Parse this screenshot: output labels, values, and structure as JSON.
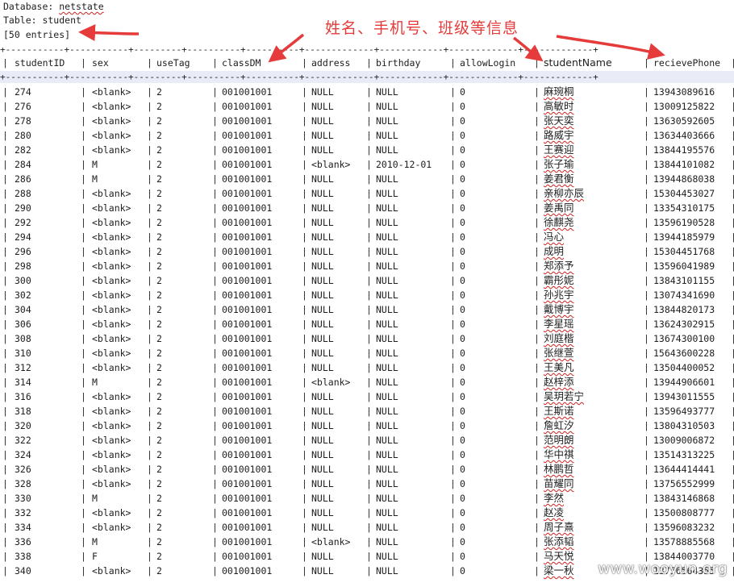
{
  "meta": {
    "db_label": "Database: ",
    "db_name": "netstate",
    "table_label": "Table: student",
    "entries": "[50 entries]"
  },
  "annotation": {
    "text": "姓名、手机号、班级等信息",
    "color": "#e53b3b"
  },
  "table": {
    "separator": "+-----------+-----------+---------+----------+----------+-------------+------------+-------------+-------------+",
    "columns": [
      "studentID",
      "sex",
      "useTag",
      "classDM",
      "address",
      "birthday",
      "allowLogin",
      "studentName",
      "recievePhone"
    ],
    "rows": [
      [
        "274",
        "<blank>",
        "2",
        "001001001",
        "NULL",
        "NULL",
        "0",
        "麻琬桐",
        "13943089616"
      ],
      [
        "276",
        "<blank>",
        "2",
        "001001001",
        "NULL",
        "NULL",
        "0",
        "高敏时",
        "13009125822"
      ],
      [
        "278",
        "<blank>",
        "2",
        "001001001",
        "NULL",
        "NULL",
        "0",
        "张天奕",
        "13630592605"
      ],
      [
        "280",
        "<blank>",
        "2",
        "001001001",
        "NULL",
        "NULL",
        "0",
        "路威宇",
        "13634403666"
      ],
      [
        "282",
        "<blank>",
        "2",
        "001001001",
        "NULL",
        "NULL",
        "0",
        "王赛迎",
        "13844195576"
      ],
      [
        "284",
        "M",
        "2",
        "001001001",
        "<blank>",
        "2010-12-01",
        "0",
        "张子瑜",
        "13844101082"
      ],
      [
        "286",
        "M",
        "2",
        "001001001",
        "NULL",
        "NULL",
        "0",
        "姜君衡",
        "13944868038"
      ],
      [
        "288",
        "<blank>",
        "2",
        "001001001",
        "NULL",
        "NULL",
        "0",
        "亲柳亦辰",
        "15304453027"
      ],
      [
        "290",
        "<blank>",
        "2",
        "001001001",
        "NULL",
        "NULL",
        "0",
        "姜禹同",
        "13354310175"
      ],
      [
        "292",
        "<blank>",
        "2",
        "001001001",
        "NULL",
        "NULL",
        "0",
        "徐麒尧",
        "13596190528"
      ],
      [
        "294",
        "<blank>",
        "2",
        "001001001",
        "NULL",
        "NULL",
        "0",
        "冯心",
        "13944185979"
      ],
      [
        "296",
        "<blank>",
        "2",
        "001001001",
        "NULL",
        "NULL",
        "0",
        "成明",
        "15304451768"
      ],
      [
        "298",
        "<blank>",
        "2",
        "001001001",
        "NULL",
        "NULL",
        "0",
        "郑添予",
        "13596041989"
      ],
      [
        "300",
        "<blank>",
        "2",
        "001001001",
        "NULL",
        "NULL",
        "0",
        "霸彤妮",
        "13843101155"
      ],
      [
        "302",
        "<blank>",
        "2",
        "001001001",
        "NULL",
        "NULL",
        "0",
        "孙兆宇",
        "13074341690"
      ],
      [
        "304",
        "<blank>",
        "2",
        "001001001",
        "NULL",
        "NULL",
        "0",
        "戴博宇",
        "13844820173"
      ],
      [
        "306",
        "<blank>",
        "2",
        "001001001",
        "NULL",
        "NULL",
        "0",
        "李星瑶",
        "13624302915"
      ],
      [
        "308",
        "<blank>",
        "2",
        "001001001",
        "NULL",
        "NULL",
        "0",
        "刘庭楷",
        "13674300100"
      ],
      [
        "310",
        "<blank>",
        "2",
        "001001001",
        "NULL",
        "NULL",
        "0",
        "张继萱",
        "15643600228"
      ],
      [
        "312",
        "<blank>",
        "2",
        "001001001",
        "NULL",
        "NULL",
        "0",
        "王美凡",
        "13504400052"
      ],
      [
        "314",
        "M",
        "2",
        "001001001",
        "<blank>",
        "NULL",
        "0",
        "赵梓添",
        "13944906601"
      ],
      [
        "316",
        "<blank>",
        "2",
        "001001001",
        "NULL",
        "NULL",
        "0",
        "吴玥若宁",
        "13943011555"
      ],
      [
        "318",
        "<blank>",
        "2",
        "001001001",
        "NULL",
        "NULL",
        "0",
        "王斯诺",
        "13596493777"
      ],
      [
        "320",
        "<blank>",
        "2",
        "001001001",
        "NULL",
        "NULL",
        "0",
        "詹虹汐",
        "13804310503"
      ],
      [
        "322",
        "<blank>",
        "2",
        "001001001",
        "NULL",
        "NULL",
        "0",
        "范明朗",
        "13009006872"
      ],
      [
        "324",
        "<blank>",
        "2",
        "001001001",
        "NULL",
        "NULL",
        "0",
        "华中祺",
        "13514313225"
      ],
      [
        "326",
        "<blank>",
        "2",
        "001001001",
        "NULL",
        "NULL",
        "0",
        "林鹏哲",
        "13644414441"
      ],
      [
        "328",
        "<blank>",
        "2",
        "001001001",
        "NULL",
        "NULL",
        "0",
        "苗耀同",
        "13756552999"
      ],
      [
        "330",
        "M",
        "2",
        "001001001",
        "NULL",
        "NULL",
        "0",
        "李然",
        "13843146868"
      ],
      [
        "332",
        "<blank>",
        "2",
        "001001001",
        "NULL",
        "NULL",
        "0",
        "赵凌",
        "13500808777"
      ],
      [
        "334",
        "<blank>",
        "2",
        "001001001",
        "NULL",
        "NULL",
        "0",
        "周子熹",
        "13596083232"
      ],
      [
        "336",
        "M",
        "2",
        "001001001",
        "<blank>",
        "NULL",
        "0",
        "张添韬",
        "13578885568"
      ],
      [
        "338",
        "F",
        "2",
        "001001001",
        "NULL",
        "NULL",
        "0",
        "马天悦",
        "13844003770"
      ],
      [
        "340",
        "<blank>",
        "2",
        "001001001",
        "NULL",
        "NULL",
        "0",
        "梁一秋",
        "13756564355"
      ]
    ]
  },
  "watermark": "www.wooyun.org"
}
